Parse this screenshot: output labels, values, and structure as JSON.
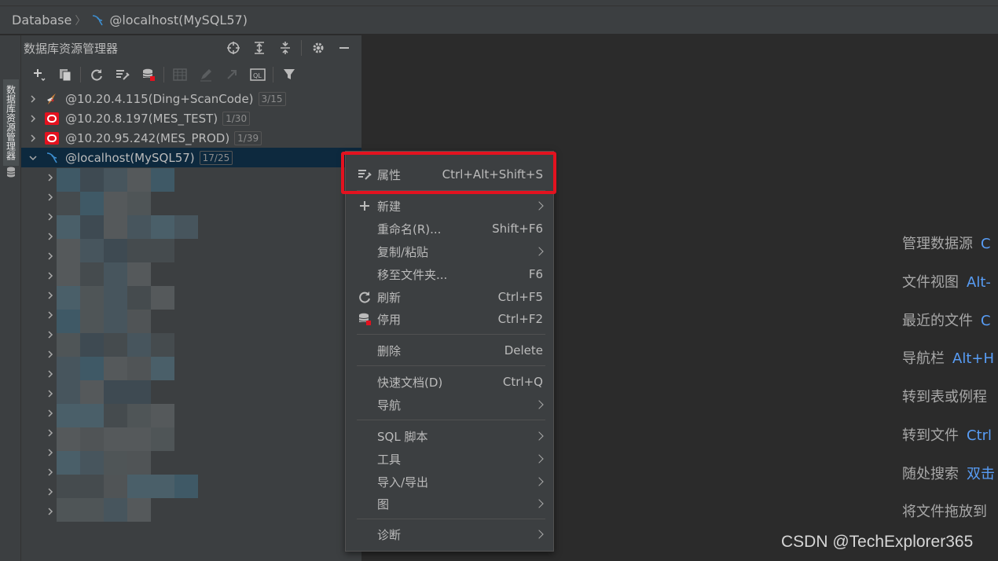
{
  "breadcrumb": {
    "root": "Database",
    "current": "@localhost(MySQL57)"
  },
  "left_strip": {
    "tab_label": "数据库资源管理器"
  },
  "panel": {
    "title": "数据库资源管理器",
    "header_icons": [
      "crosshair-icon",
      "expand-all-icon",
      "collapse-all-icon",
      "gear-icon",
      "minimize-icon"
    ],
    "toolbar_icons": [
      "add-icon",
      "duplicate-icon",
      "refresh-icon",
      "properties-icon",
      "disable-datasource-icon",
      "table-icon",
      "edit-icon",
      "jump-icon",
      "query-console-icon",
      "filter-icon"
    ]
  },
  "tree": {
    "datasources": [
      {
        "name": "@10.20.4.115(Ding+ScanCode)",
        "badge": "3/15",
        "icon": "sqlserver-icon",
        "expanded": false
      },
      {
        "name": "@10.20.8.197(MES_TEST)",
        "badge": "1/30",
        "icon": "oracle-icon",
        "expanded": false
      },
      {
        "name": "@10.20.95.242(MES_PROD)",
        "badge": "1/39",
        "icon": "oracle-icon",
        "expanded": false
      },
      {
        "name": "@localhost(MySQL57)",
        "badge": "17/25",
        "icon": "mysql-icon",
        "expanded": true,
        "selected": true
      }
    ],
    "child_rows_count": 18
  },
  "context_menu": {
    "items": [
      {
        "label": "属性",
        "shortcut": "Ctrl+Alt+Shift+S",
        "icon": "properties-icon",
        "highlighted": true
      },
      {
        "label": "新建",
        "submenu": true,
        "icon": "plus-icon"
      },
      {
        "label": "重命名(R)...",
        "shortcut": "Shift+F6"
      },
      {
        "label": "复制/粘贴",
        "submenu": true
      },
      {
        "label": "移至文件夹...",
        "shortcut": "F6"
      },
      {
        "label": "刷新",
        "shortcut": "Ctrl+F5",
        "icon": "refresh-icon"
      },
      {
        "label": "停用",
        "shortcut": "Ctrl+F2",
        "icon": "disable-datasource-icon"
      },
      {
        "label": "删除",
        "shortcut": "Delete"
      },
      {
        "label": "快速文档(D)",
        "shortcut": "Ctrl+Q"
      },
      {
        "label": "导航",
        "submenu": true
      },
      {
        "label": "SQL 脚本",
        "submenu": true
      },
      {
        "label": "工具",
        "submenu": true
      },
      {
        "label": "导入/导出",
        "submenu": true
      },
      {
        "label": "图",
        "submenu": true
      },
      {
        "label": "诊断",
        "submenu": true
      }
    ]
  },
  "editor_hints": [
    {
      "label": "管理数据源",
      "key": "C"
    },
    {
      "label": "文件视图",
      "key": "Alt-"
    },
    {
      "label": "最近的文件",
      "key": "C"
    },
    {
      "label": "导航栏",
      "key": "Alt+H"
    },
    {
      "label": "转到表或例程",
      "key": ""
    },
    {
      "label": "转到文件",
      "key": "Ctrl"
    },
    {
      "label": "随处搜索",
      "key": "双击"
    },
    {
      "label": "将文件拖放到",
      "key": ""
    }
  ],
  "watermark": "CSDN @TechExplorer365",
  "colors": {
    "accent": "#589df6",
    "highlight_box": "#e3121f",
    "selection": "#0d293e",
    "oracle_red": "#e3121f"
  }
}
